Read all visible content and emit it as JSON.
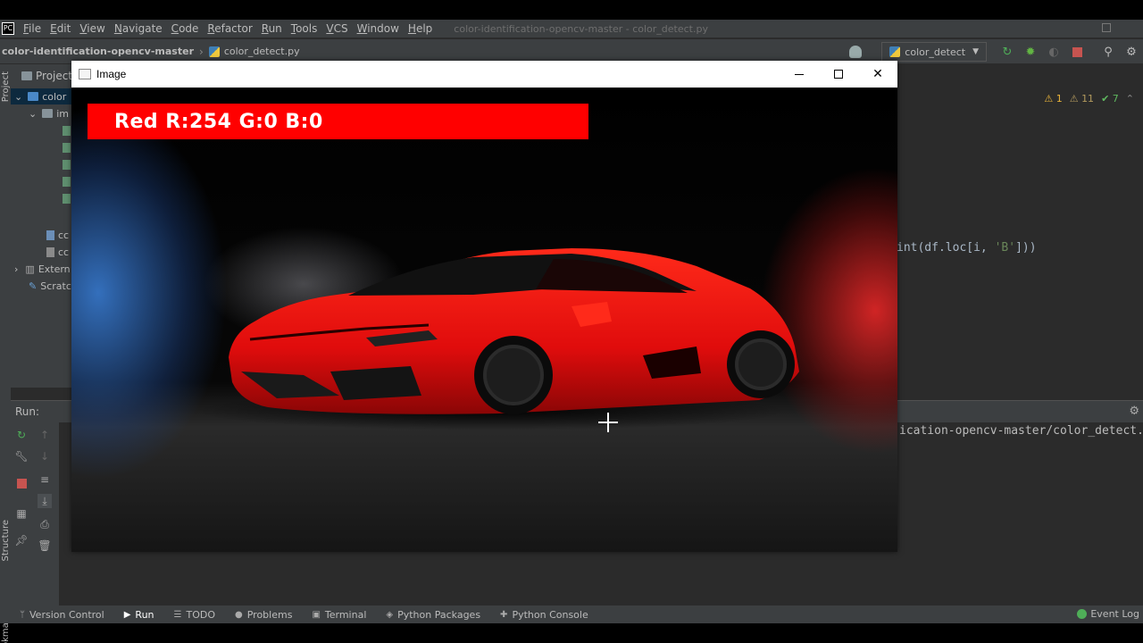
{
  "ide": {
    "menu": [
      "File",
      "Edit",
      "View",
      "Navigate",
      "Code",
      "Refactor",
      "Run",
      "Tools",
      "VCS",
      "Window",
      "Help"
    ],
    "window_title": "color-identification-opencv-master - color_detect.py",
    "breadcrumb_root": "color-identification-opencv-master",
    "breadcrumb_file": "color_detect.py",
    "run_config": "color_detect",
    "stripe_project": "Project",
    "stripe_structure": "Structure",
    "stripe_bookmarks": "Bookmarks"
  },
  "project_panel": {
    "header": "Project",
    "tree": [
      {
        "label": "color",
        "type": "folder-blue"
      },
      {
        "label": "im",
        "type": "folder"
      },
      {
        "label": "",
        "type": "file"
      },
      {
        "label": "",
        "type": "file"
      },
      {
        "label": "",
        "type": "file"
      },
      {
        "label": "",
        "type": "file"
      },
      {
        "label": "",
        "type": "file"
      },
      {
        "label": "cc",
        "type": "file"
      },
      {
        "label": "cc",
        "type": "file"
      },
      {
        "label": "Extern",
        "type": "folder"
      },
      {
        "label": "Scratc",
        "type": "folder"
      }
    ]
  },
  "editor": {
    "inspections": {
      "warnings_a": "1",
      "warnings_b": "11",
      "ok": "7"
    },
    "code_prefix": "int(df.loc[i, ",
    "code_string": "'B'",
    "code_suffix": "]))"
  },
  "run_panel": {
    "label": "Run:",
    "output": "ication-opencv-master/color_detect.p"
  },
  "statusbar": {
    "items": [
      "Version Control",
      "Run",
      "TODO",
      "Problems",
      "Terminal",
      "Python Packages",
      "Python Console"
    ],
    "event_log": "Event Log"
  },
  "image_window": {
    "title": "Image",
    "banner_text": "Red R:254 G:0 B:0",
    "banner_color": "#ff0000"
  }
}
